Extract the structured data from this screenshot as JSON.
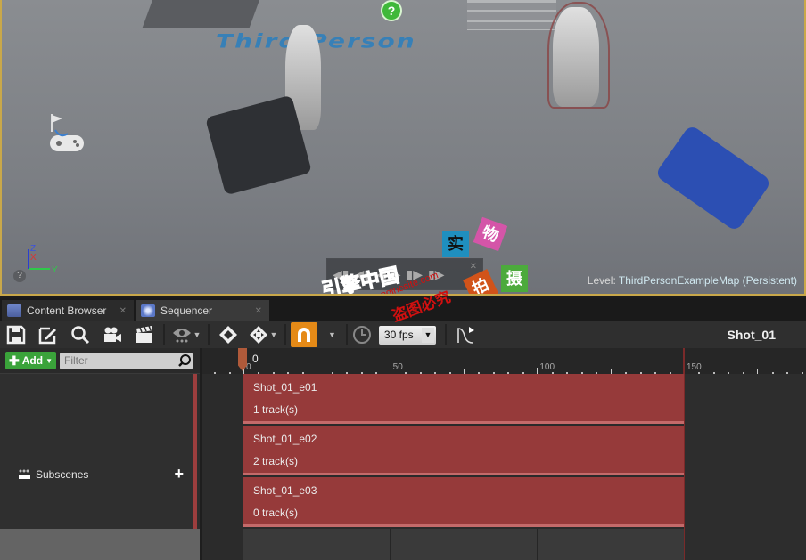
{
  "viewport": {
    "floor_text": "Third Person",
    "level_prefix": "Level:",
    "level_name": "ThirdPersonExampleMap (Persistent)",
    "axis_labels": {
      "z": "Z",
      "x": "X",
      "y": "Y"
    },
    "help_glyph": "?",
    "playback_controls": [
      "jump-to-start-icon",
      "step-back-icon",
      "play-reverse-icon",
      "play-icon",
      "step-forward-icon",
      "jump-to-end-icon"
    ],
    "watermark": {
      "tiles": [
        "实",
        "物",
        "拍",
        "摄"
      ],
      "text_main": "引擎中国",
      "text_url": "www.enginesite.com",
      "text_sub": "盗图必究"
    }
  },
  "tabs": [
    {
      "label": "Content Browser",
      "icon": "content-browser-icon",
      "active": false
    },
    {
      "label": "Sequencer",
      "icon": "sequencer-icon",
      "active": true
    }
  ],
  "toolbar": {
    "buttons": [
      "save-icon",
      "save-as-icon",
      "find-asset-icon",
      "camera-icon",
      "clapperboard-icon",
      "view-options-icon",
      "key-icon",
      "transform-keys-icon",
      "snap-magnet-icon",
      "playback-rate-icon",
      "curve-editor-icon"
    ],
    "fps_value": "30 fps",
    "sequence_name": "Shot_01"
  },
  "left_panel": {
    "add_label": "Add",
    "filter_placeholder": "Filter",
    "track_label": "Subscenes"
  },
  "timeline": {
    "current_frame": "0",
    "tick_labels": [
      "0",
      "50",
      "100",
      "150"
    ],
    "accent_color": "#963a3a",
    "shots": [
      {
        "name": "Shot_01_e01",
        "tracks": "1 track(s)"
      },
      {
        "name": "Shot_01_e02",
        "tracks": "2 track(s)"
      },
      {
        "name": "Shot_01_e03",
        "tracks": "0 track(s)"
      }
    ]
  }
}
